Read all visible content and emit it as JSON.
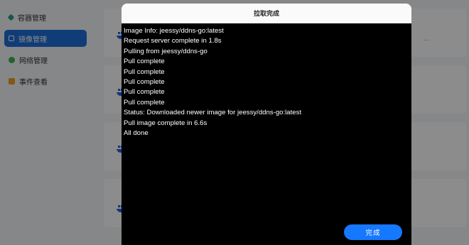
{
  "sidebar": {
    "items": [
      {
        "label": "容器管理",
        "icon": "cube-icon",
        "color": "#2a9d8f"
      },
      {
        "label": "镜像管理",
        "icon": "image-icon",
        "color": "#ffffff"
      },
      {
        "label": "网络管理",
        "icon": "globe-icon",
        "color": "#3cb44b"
      },
      {
        "label": "事件查看",
        "icon": "calendar-icon",
        "color": "#f0a020"
      }
    ]
  },
  "modal": {
    "title": "拉取完成",
    "log": [
      "Image Info: jeessy/ddns-go:latest",
      "Request server complete in 1.8s",
      "Pulling from jeessy/ddns-go",
      "Pull complete",
      "Pull complete",
      "Pull complete",
      "Pull complete",
      "Pull complete",
      "Status: Downloaded newer image for jeessy/ddns-go:latest",
      "Pull image complete in 6.6s",
      "All done"
    ],
    "done_label": "完成"
  },
  "colors": {
    "accent": "#1677ff",
    "active_nav": "#1e6fd9",
    "terminal_bg": "#000000"
  }
}
